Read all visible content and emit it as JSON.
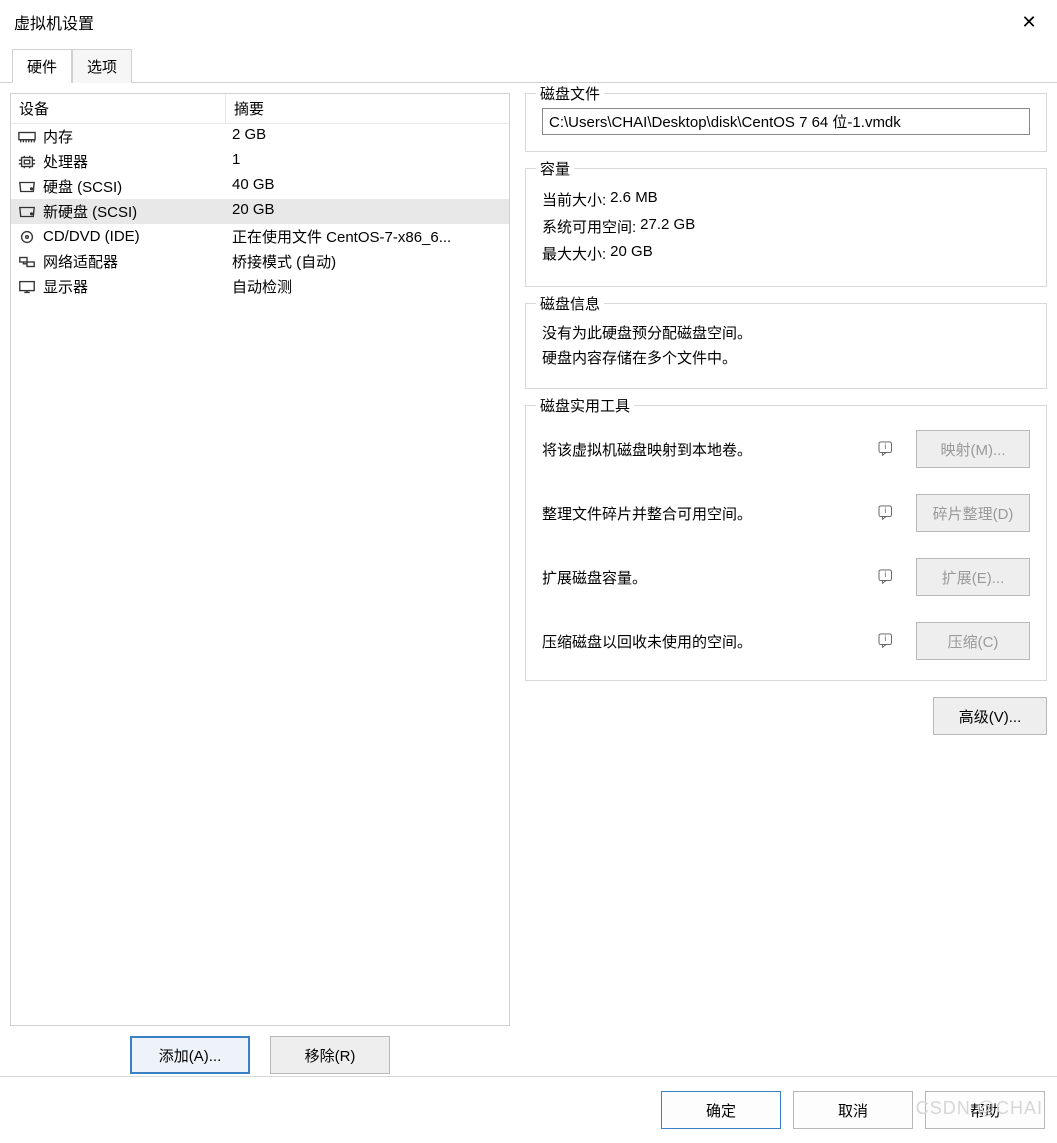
{
  "window": {
    "title": "虚拟机设置"
  },
  "tabs": {
    "hardware": "硬件",
    "options": "选项"
  },
  "deviceList": {
    "colDevice": "设备",
    "colSummary": "摘要",
    "rows": [
      {
        "icon": "memory",
        "name": "内存",
        "summary": "2 GB"
      },
      {
        "icon": "cpu",
        "name": "处理器",
        "summary": "1"
      },
      {
        "icon": "disk",
        "name": "硬盘 (SCSI)",
        "summary": "40 GB"
      },
      {
        "icon": "disk",
        "name": "新硬盘 (SCSI)",
        "summary": "20 GB"
      },
      {
        "icon": "cd",
        "name": "CD/DVD (IDE)",
        "summary": "正在使用文件 CentOS-7-x86_6..."
      },
      {
        "icon": "net",
        "name": "网络适配器",
        "summary": "桥接模式 (自动)"
      },
      {
        "icon": "display",
        "name": "显示器",
        "summary": "自动检测"
      }
    ]
  },
  "right": {
    "diskFile": {
      "legend": "磁盘文件",
      "path": "C:\\Users\\CHAI\\Desktop\\disk\\CentOS 7 64 位-1.vmdk"
    },
    "capacity": {
      "legend": "容量",
      "currentLabel": "当前大小:",
      "currentValue": "2.6 MB",
      "freeLabel": "系统可用空间:",
      "freeValue": "27.2 GB",
      "maxLabel": "最大大小:",
      "maxValue": "20 GB"
    },
    "diskInfo": {
      "legend": "磁盘信息",
      "line1": "没有为此硬盘预分配磁盘空间。",
      "line2": "硬盘内容存储在多个文件中。"
    },
    "utils": {
      "legend": "磁盘实用工具",
      "map": {
        "label": "将该虚拟机磁盘映射到本地卷。",
        "btn": "映射(M)..."
      },
      "defrag": {
        "label": "整理文件碎片并整合可用空间。",
        "btn": "碎片整理(D)"
      },
      "expand": {
        "label": "扩展磁盘容量。",
        "btn": "扩展(E)..."
      },
      "compact": {
        "label": "压缩磁盘以回收未使用的空间。",
        "btn": "压缩(C)"
      }
    },
    "advanced": "高级(V)..."
  },
  "leftButtons": {
    "add": "添加(A)...",
    "remove": "移除(R)"
  },
  "footer": {
    "ok": "确定",
    "cancel": "取消",
    "help": "帮助"
  },
  "watermark": "CSDN @CHAI"
}
